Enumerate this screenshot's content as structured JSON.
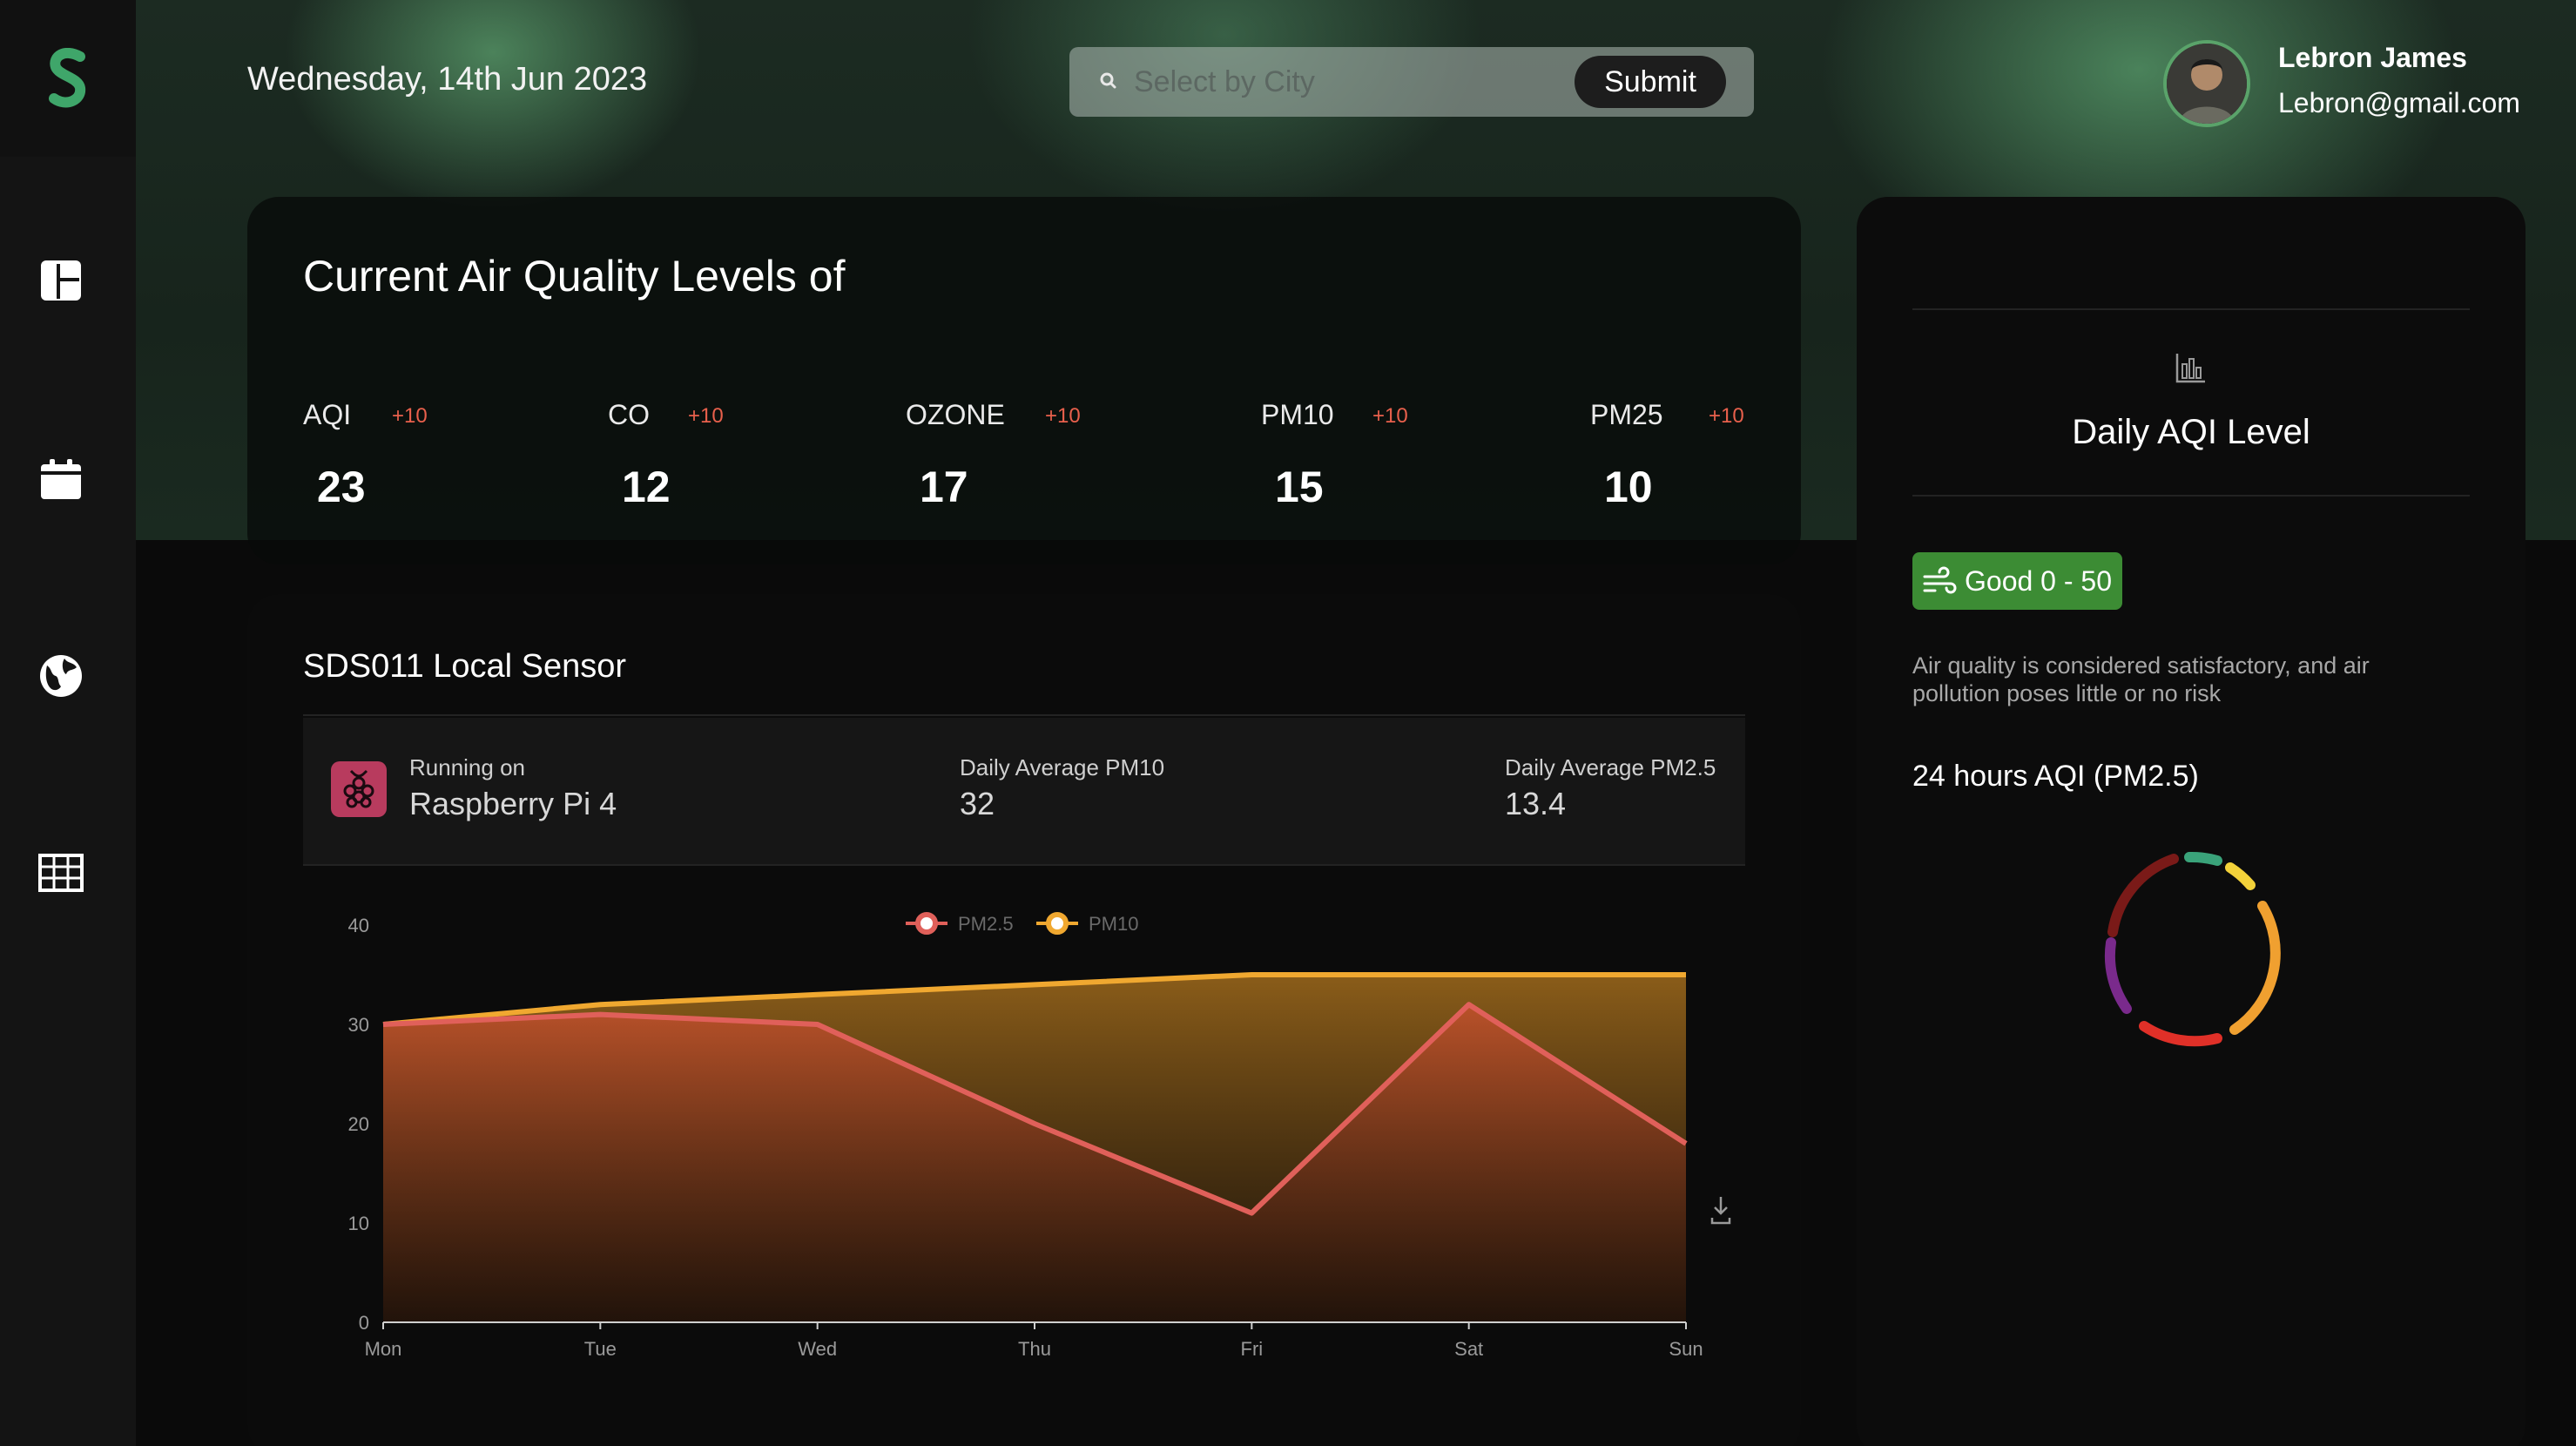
{
  "header": {
    "date": "Wednesday, 14th Jun 2023",
    "search_placeholder": "Select by City",
    "submit_label": "Submit"
  },
  "user": {
    "name": "Lebron James",
    "email": "Lebron@gmail.com"
  },
  "sidebar": {
    "items": [
      "logo-icon",
      "dashboard-icon",
      "calendar-icon",
      "globe-icon",
      "table-icon"
    ]
  },
  "air_quality": {
    "title": "Current Air Quality Levels of",
    "metrics": [
      {
        "label": "AQI",
        "delta": "+10",
        "value": "23"
      },
      {
        "label": "CO",
        "delta": "+10",
        "value": "12"
      },
      {
        "label": "OZONE",
        "delta": "+10",
        "value": "17"
      },
      {
        "label": "PM10",
        "delta": "+10",
        "value": "15"
      },
      {
        "label": "PM25",
        "delta": "+10",
        "value": "10"
      }
    ]
  },
  "sensor": {
    "title": "SDS011 Local Sensor",
    "running_on_label": "Running on",
    "device": "Raspberry Pi 4",
    "avg_pm10_label": "Daily Average PM10",
    "avg_pm10": "32",
    "avg_pm25_label": "Daily Average PM2.5",
    "avg_pm25": "13.4"
  },
  "daily_aqi": {
    "title": "Daily AQI Level",
    "badge": "Good 0 - 50",
    "description": "Air quality is considered satisfactory, and air pollution poses little or no risk",
    "chart_title": "24 hours AQI (PM2.5)"
  },
  "colors": {
    "accent_green": "#3c8c34",
    "delta_red": "#e8604c",
    "pm25": "#e0605a",
    "pm10": "#f0a830"
  },
  "chart_data": {
    "type": "area",
    "categories": [
      "Mon",
      "Tue",
      "Wed",
      "Thu",
      "Fri",
      "Sat",
      "Sun"
    ],
    "series": [
      {
        "name": "PM2.5",
        "values": [
          30,
          31,
          30,
          20,
          11,
          32,
          18
        ]
      },
      {
        "name": "PM10",
        "values": [
          30,
          32,
          33,
          34,
          35,
          35,
          35
        ]
      }
    ],
    "ylim": [
      0,
      40
    ],
    "yticks": [
      0,
      10,
      20,
      30,
      40
    ],
    "legend": "top-center"
  }
}
